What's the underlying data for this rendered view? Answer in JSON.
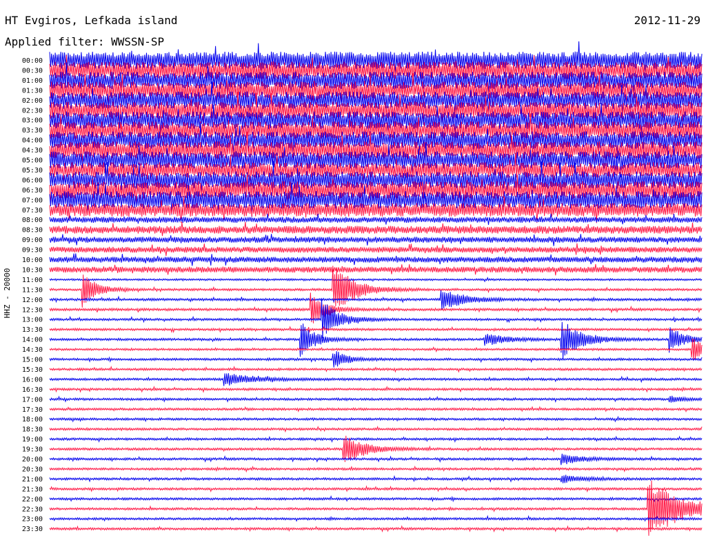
{
  "header": {
    "station": "HT Evgiros, Lefkada island",
    "filter": "Applied filter: WWSSN-SP",
    "date": "2012-11-29"
  },
  "chart_data": {
    "type": "helicorder",
    "channel_label": "HHZ - 20000",
    "row_labels": [
      "00:00",
      "00:30",
      "01:00",
      "01:30",
      "02:00",
      "02:30",
      "03:00",
      "03:30",
      "04:00",
      "04:30",
      "05:00",
      "05:30",
      "06:00",
      "06:30",
      "07:00",
      "07:30",
      "08:00",
      "08:30",
      "09:00",
      "09:30",
      "10:00",
      "10:30",
      "11:00",
      "11:30",
      "12:00",
      "12:30",
      "13:00",
      "13:30",
      "14:00",
      "14:30",
      "15:00",
      "15:30",
      "16:00",
      "16:30",
      "17:00",
      "17:30",
      "18:00",
      "18:30",
      "19:00",
      "19:30",
      "20:00",
      "20:30",
      "21:00",
      "21:30",
      "22:00",
      "22:30",
      "23:00",
      "23:30"
    ],
    "trace_colors": [
      "#0000ee",
      "#ff1744"
    ],
    "row_noise_level": [
      9,
      9,
      9,
      9,
      9,
      9,
      9,
      9,
      9,
      9,
      9,
      8,
      9,
      9,
      9,
      7,
      3,
      4,
      3,
      3,
      3,
      3,
      1,
      1.2,
      1.3,
      1.3,
      1.2,
      1.2,
      1.2,
      1.1,
      1.2,
      1.2,
      1.2,
      1.2,
      1.2,
      1.2,
      1.2,
      1.2,
      1.2,
      1.2,
      1.2,
      1.2,
      1.2,
      1.2,
      1.2,
      1.2,
      1.2,
      1.2
    ],
    "events": [
      {
        "row": 23,
        "minute": 1.5,
        "amplitude": 25,
        "duration_min": 1
      },
      {
        "row": 23,
        "minute": 13,
        "amplitude": 40,
        "duration_min": 1.5
      },
      {
        "row": 24,
        "minute": 18,
        "amplitude": 18,
        "duration_min": 1.5
      },
      {
        "row": 25,
        "minute": 12,
        "amplitude": 25,
        "duration_min": 1
      },
      {
        "row": 26,
        "minute": 12.5,
        "amplitude": 30,
        "duration_min": 1.2
      },
      {
        "row": 28,
        "minute": 11.5,
        "amplitude": 28,
        "duration_min": 1
      },
      {
        "row": 28,
        "minute": 23.5,
        "amplitude": 30,
        "duration_min": 1.5
      },
      {
        "row": 28,
        "minute": 20,
        "amplitude": 10,
        "duration_min": 1.5
      },
      {
        "row": 28,
        "minute": 28.5,
        "amplitude": 20,
        "duration_min": 1
      },
      {
        "row": 29,
        "minute": 29.5,
        "amplitude": 20,
        "duration_min": 1
      },
      {
        "row": 30,
        "minute": 13,
        "amplitude": 15,
        "duration_min": 1
      },
      {
        "row": 32,
        "minute": 8,
        "amplitude": 10,
        "duration_min": 2
      },
      {
        "row": 33,
        "minute": 31.5,
        "amplitude": 25,
        "duration_min": 1.5
      },
      {
        "row": 34,
        "minute": 28.5,
        "amplitude": 5,
        "duration_min": 1
      },
      {
        "row": 35,
        "minute": 53.5,
        "amplitude": 20,
        "duration_min": 1.5
      },
      {
        "row": 37,
        "minute": 55,
        "amplitude": 18,
        "duration_min": 3
      },
      {
        "row": 39,
        "minute": 13.5,
        "amplitude": 22,
        "duration_min": 1.5
      },
      {
        "row": 40,
        "minute": 23.5,
        "amplitude": 8,
        "duration_min": 1.5
      },
      {
        "row": 40,
        "minute": 30.5,
        "amplitude": 18,
        "duration_min": 1.5
      },
      {
        "row": 41,
        "minute": 37.5,
        "amplitude": 14,
        "duration_min": 1
      },
      {
        "row": 42,
        "minute": 23.5,
        "amplitude": 6,
        "duration_min": 1.5
      },
      {
        "row": 45,
        "minute": 27.5,
        "amplitude": 45,
        "duration_min": 2.5
      },
      {
        "row": 46,
        "minute": 37,
        "amplitude": 8,
        "duration_min": 1
      }
    ]
  }
}
